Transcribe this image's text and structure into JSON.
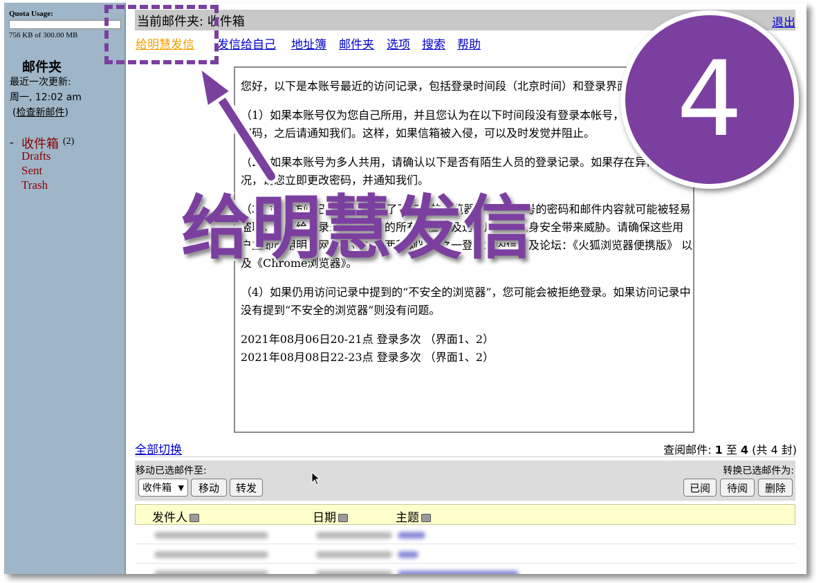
{
  "sidebar": {
    "quota_title": "Quota Usage:",
    "quota_text": "756 KB of 300.00 MB",
    "folders_heading": "邮件夹",
    "last_update_label": "最近一次更新:",
    "last_update_time": "周一, 12:02 am",
    "check_mail_open": "(",
    "check_mail": "检查新邮件",
    "check_mail_close": ")",
    "inbox_dash": "-",
    "inbox": "收件箱",
    "inbox_count": "(2)",
    "drafts": "Drafts",
    "sent": "Sent",
    "trash": "Trash"
  },
  "header": {
    "current_folder": "当前邮件夹: 收件箱",
    "logout": "退出"
  },
  "nav": {
    "compose_to_minghui": "给明慧发信",
    "send_to_self": "发信给自己",
    "address_book": "地址簿",
    "folders": "邮件夹",
    "options": "选项",
    "search": "搜索",
    "help": "帮助"
  },
  "notice": {
    "p1": "您好，以下是本账号最近的访问记录，包括登录时间段（北京时间）和登录界面登录的。",
    "p2": "（1）如果本账号仅为您自己所用，并且您认为在以下时间段没有登录本帐号，建议立即更改密码，之后请通知我们。这样，如果信箱被入侵，可以及时发觉并阻止。",
    "p3": "（2）如果本账号为多人共用，请确认以下是否有陌生人员的登录记录。如果存在异常登录情况，请您立即更改密码，并通知我们。",
    "p4": "（3）如果访问记录中提到“用了不安全的浏览器”，这个账号的密码和邮件内容就可能被轻易盗取，从而给登录这个帐号的的所有电脑以及这些用户的人身安全带来威胁。请确保这些用户立即改用明慧网最近推荐的两种浏览器之一登录站内信箱及论坛：《火狐浏览器便携版》 以及《Chrome浏览器》。",
    "p5": "（4）如果仍用访问记录中提到的“不安全的浏览器”，您可能会被拒绝登录。如果访问记录中没有提到“不安全的浏览器”则没有问题。",
    "log1": "2021年08月06日20-21点 登录多次 （界面1、2）",
    "log2": "2021年08月08日22-23点 登录多次 （界面1、2）"
  },
  "list_controls": {
    "toggle_all": "全部切换",
    "view_label": "查阅邮件:",
    "view_from": "1",
    "view_to_word": "至",
    "view_to": "4",
    "view_total": "(共 4 封)",
    "move_label": "移动已选邮件至:",
    "convert_label": "转换已选邮件为:",
    "folder_select_value": "收件箱",
    "move_button": "移动",
    "forward_button": "转发",
    "read_button": "已阅",
    "unread_button": "待阅",
    "delete_button": "删除"
  },
  "table": {
    "col_from": "发件人",
    "col_date": "日期",
    "col_subject": "主题"
  },
  "overlay": {
    "big_label": "给明慧发信",
    "step_number": "4",
    "accent_color": "#7b3fa0"
  }
}
